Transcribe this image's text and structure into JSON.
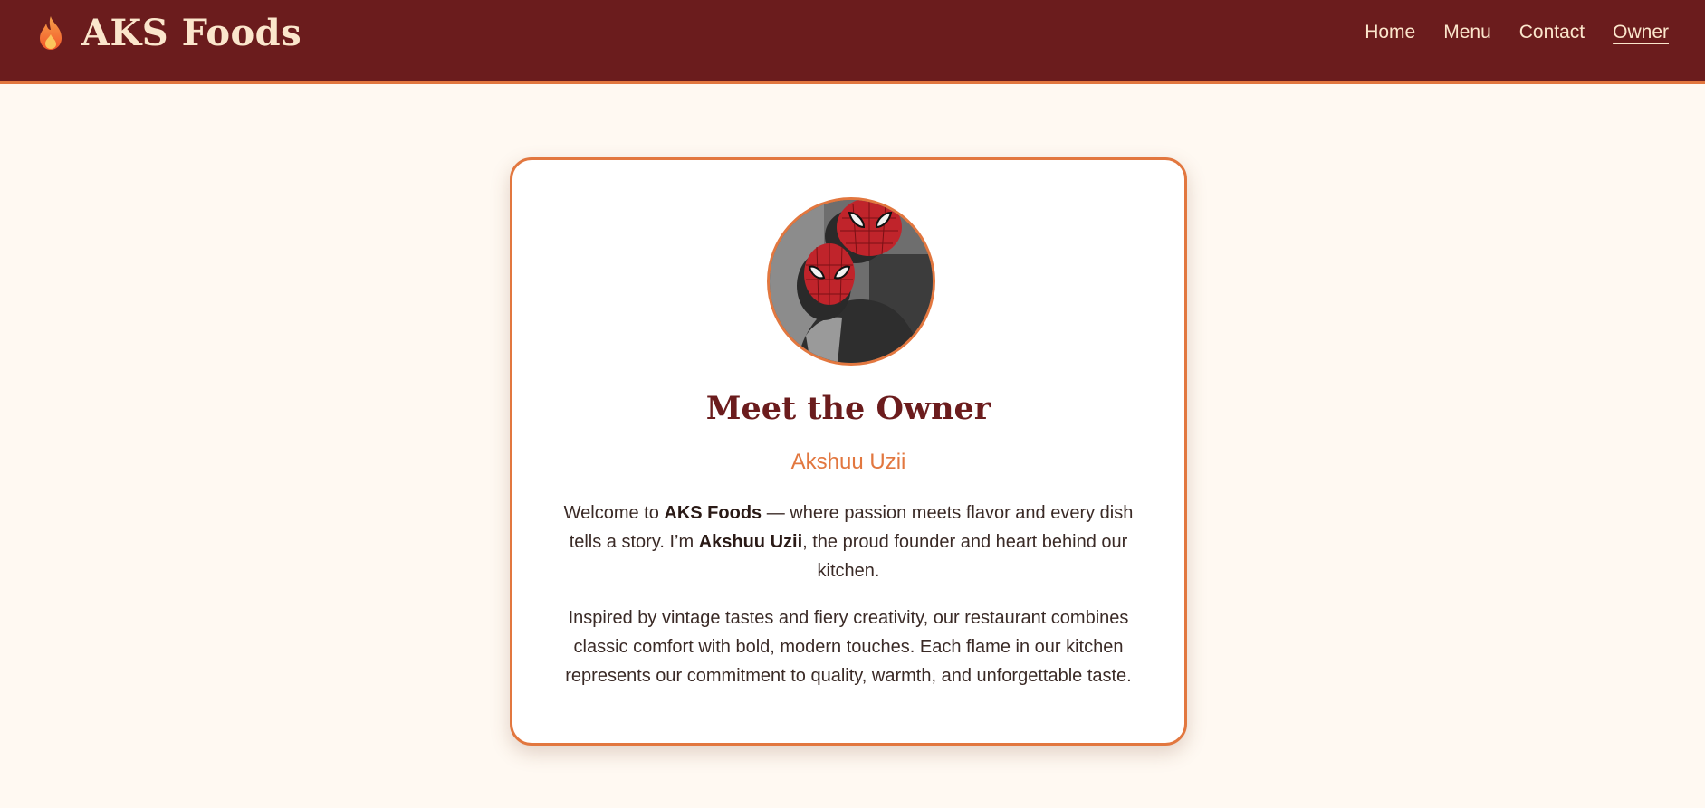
{
  "brand": {
    "name": "AKS Foods",
    "icon": "flame-icon"
  },
  "nav": {
    "items": [
      {
        "label": "Home",
        "active": false
      },
      {
        "label": "Menu",
        "active": false
      },
      {
        "label": "Contact",
        "active": false
      },
      {
        "label": "Owner",
        "active": true
      }
    ]
  },
  "owner": {
    "title": "Meet the Owner",
    "name": "Akshuu Uzii",
    "photo": "owner-avatar",
    "paragraph1": {
      "pre": "Welcome to ",
      "brand": "AKS Foods",
      "mid": " — where passion meets flavor and every dish tells a story. I’m ",
      "name": "Akshuu Uzii",
      "post": ", the proud founder and heart behind our kitchen."
    },
    "paragraph2": "Inspired by vintage tastes and fiery creativity, our restaurant combines classic comfort with bold, modern touches. Each flame in our kitchen represents our commitment to quality, warmth, and unforgettable taste."
  },
  "colors": {
    "header_bg": "#6b1c1d",
    "accent": "#e2773f",
    "page_bg": "#fff9f2",
    "header_text": "#fbe6cc"
  }
}
